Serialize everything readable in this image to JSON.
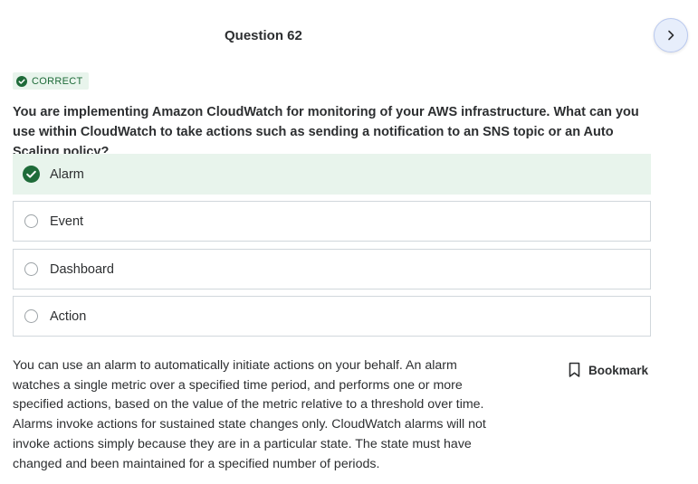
{
  "question": {
    "title": "Question 62",
    "status_badge": "CORRECT",
    "text": "You are implementing Amazon CloudWatch for monitoring of your AWS infrastructure. What can you use within CloudWatch to take actions such as sending a notification to an SNS topic or an Auto Scaling policy?"
  },
  "options": [
    {
      "label": "Alarm",
      "state": "correct-selected"
    },
    {
      "label": "Event",
      "state": "unselected"
    },
    {
      "label": "Dashboard",
      "state": "unselected"
    },
    {
      "label": "Action",
      "state": "unselected"
    }
  ],
  "explanation": "You can use an alarm to automatically initiate actions on your behalf. An alarm watches a single metric over a specified time period, and performs one or more specified actions, based on the value of the metric relative to a threshold over time. Alarms invoke actions for sustained state changes only. CloudWatch alarms will not invoke actions simply because they are in a particular state. The state must have changed and been maintained for a specified number of periods.",
  "bookmark": {
    "label": "Bookmark"
  },
  "navigation": {
    "next_icon": "chevron-right-icon"
  },
  "colors": {
    "correct_green": "#1e6b39",
    "correct_bg": "#e8f4ec",
    "next_button_bg": "#e7eefb",
    "border": "#d1d7dc"
  }
}
